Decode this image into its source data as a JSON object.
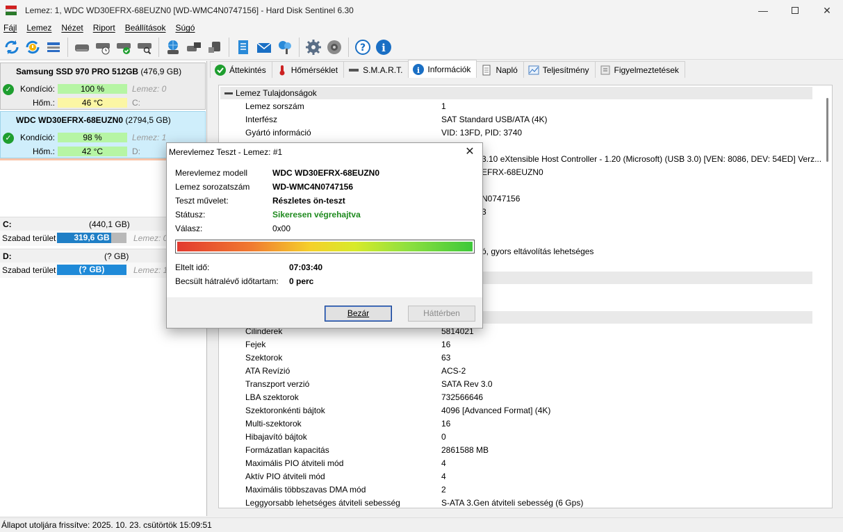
{
  "window": {
    "title": "Lemez: 1, WDC WD30EFRX-68EUZN0 [WD-WMC4N0747156]  -  Hard Disk Sentinel 6.30"
  },
  "menu": [
    "Fájl",
    "Lemez",
    "Nézet",
    "Riport",
    "Beállítások",
    "Súgó"
  ],
  "toolbar_icons": [
    "refresh-icon",
    "refresh-warning-icon",
    "disk-list-icon",
    "disk-icon",
    "disk-clock-icon",
    "disk-check-icon",
    "disk-search-icon",
    "network-disk-icon",
    "disk-tool-icon",
    "disk-usb-icon",
    "report-icon",
    "email-icon",
    "cloud-icon",
    "gear-icon",
    "speaker-icon",
    "help-icon",
    "info-icon"
  ],
  "disks": [
    {
      "name": "Samsung SSD 970 PRO 512GB",
      "size": "(476,9 GB)",
      "condition_label": "Kondíció:",
      "condition_value": "100 %",
      "condition_side": "Lemez: 0",
      "temp_label": "Hőm.:",
      "temp_value": "46 °C",
      "temp_side": "C:"
    },
    {
      "name": "WDC WD30EFRX-68EUZN0",
      "size": "(2794,5 GB)",
      "condition_label": "Kondíció:",
      "condition_value": "98 %",
      "condition_side": "Lemez: 1",
      "temp_label": "Hőm.:",
      "temp_value": "42 °C",
      "temp_side": "D:"
    }
  ],
  "volumes": [
    {
      "name": "C:",
      "size": "(440,1 GB)",
      "free_label": "Szabad terület",
      "free_value": "319,6 GB",
      "side": "Lemez: 0"
    },
    {
      "name": "D:",
      "size": "(? GB)",
      "free_label": "Szabad terület",
      "free_value": "(? GB)",
      "side": "Lemez: 1"
    }
  ],
  "status_bar": "Állapot utoljára frissítve: 2025. 10. 23. csütörtök 15:09:51",
  "tabs": [
    {
      "label": "Áttekintés",
      "icon": "check-circle-icon"
    },
    {
      "label": "Hőmérséklet",
      "icon": "thermometer-icon"
    },
    {
      "label": "S.M.A.R.T.",
      "icon": "smart-icon"
    },
    {
      "label": "Információk",
      "icon": "info-icon"
    },
    {
      "label": "Napló",
      "icon": "document-icon"
    },
    {
      "label": "Teljesítmény",
      "icon": "chart-icon"
    },
    {
      "label": "Figyelmeztetések",
      "icon": "warning-icon"
    }
  ],
  "info": {
    "section1": "Lemez Tulajdonságok",
    "rows_top": [
      {
        "k": "Lemez sorszám",
        "v": "1"
      },
      {
        "k": "Interfész",
        "v": "SAT Standard USB/ATA (4K)"
      },
      {
        "k": "Gyártó információ",
        "v": "VID: 13FD, PID: 3740"
      },
      {
        "k": "",
        "v": "3.10 eXtensible Host Controller - 1.20 (Microsoft) (USB 3.0) [VEN: 8086, DEV: 54ED] Verz..."
      },
      {
        "k": "",
        "v": "EFRX-68EUZN0"
      },
      {
        "k": "",
        "v": "N0747156"
      },
      {
        "k": "",
        "v": "3"
      },
      {
        "k": "",
        "v": "ó, gyors eltávolítás lehetséges"
      }
    ],
    "rows_bottom": [
      {
        "k": "Cilinderek",
        "v": "5814021"
      },
      {
        "k": "Fejek",
        "v": "16"
      },
      {
        "k": "Szektorok",
        "v": "63"
      },
      {
        "k": "ATA Revízió",
        "v": "ACS-2"
      },
      {
        "k": "Transzport verzió",
        "v": "SATA Rev 3.0"
      },
      {
        "k": "LBA szektorok",
        "v": "732566646"
      },
      {
        "k": "Szektoronkénti bájtok",
        "v": "4096 [Advanced Format] (4K)"
      },
      {
        "k": "Multi-szektorok",
        "v": "16"
      },
      {
        "k": "Hibajavító bájtok",
        "v": "0"
      },
      {
        "k": "Formázatlan kapacitás",
        "v": "2861588 MB"
      },
      {
        "k": "Maximális PIO átviteli mód",
        "v": "4"
      },
      {
        "k": "Aktív PIO átviteli mód",
        "v": "4"
      },
      {
        "k": "Maximális többszavas DMA mód",
        "v": "2"
      },
      {
        "k": "Leggyorsabb lehetséges átviteli sebesség",
        "v": "S-ATA 3.Gen átviteli sebesség (6 Gps)"
      }
    ]
  },
  "dialog": {
    "title": "Merevlemez Teszt - Lemez: #1",
    "model_label": "Merevlemez modell",
    "model_value": "WDC WD30EFRX-68EUZN0",
    "serial_label": "Lemez sorozatszám",
    "serial_value": "WD-WMC4N0747156",
    "op_label": "Teszt művelet:",
    "op_value": "Részletes ön-teszt",
    "status_label": "Státusz:",
    "status_value": "Sikeresen végrehajtva",
    "answer_label": "Válasz:",
    "answer_value": "0x00",
    "progress": 1.0,
    "elapsed_label": "Eltelt idő:",
    "elapsed_value": "07:03:40",
    "remaining_label": "Becsült hátralévő időtartam:",
    "remaining_value": "0 perc",
    "close_button": "Bezár",
    "background_button": "Háttérben"
  }
}
